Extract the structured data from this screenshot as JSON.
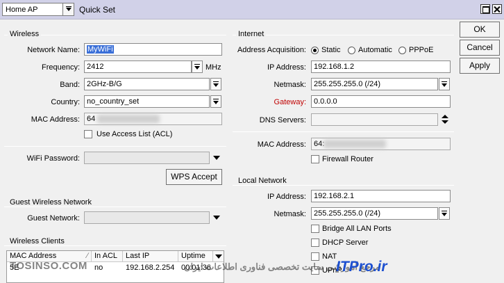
{
  "titlebar": {
    "mode_value": "Home AP",
    "title": "Quick Set"
  },
  "wireless": {
    "group_title": "Wireless",
    "network_name_label": "Network Name:",
    "network_name_value": "MyWiFi",
    "frequency_label": "Frequency:",
    "frequency_value": "2412",
    "frequency_unit": "MHz",
    "band_label": "Band:",
    "band_value": "2GHz-B/G",
    "country_label": "Country:",
    "country_value": "no_country_set",
    "mac_label": "MAC Address:",
    "mac_value_visible": "64",
    "use_acl_label": "Use Access List (ACL)",
    "wifi_password_label": "WiFi Password:",
    "wps_button": "WPS Accept"
  },
  "guest": {
    "group_title": "Guest Wireless Network",
    "network_label": "Guest Network:"
  },
  "clients": {
    "group_title": "Wireless Clients",
    "columns": [
      "MAC Address",
      "In ACL",
      "Last IP",
      "Uptime"
    ],
    "rows": [
      {
        "mac": "5E",
        "in_acl": "no",
        "last_ip": "192.168.2.254",
        "uptime": "00:01:36"
      }
    ]
  },
  "internet": {
    "group_title": "Internet",
    "acq_label": "Address Acquisition:",
    "acq_options": [
      "Static",
      "Automatic",
      "PPPoE"
    ],
    "acq_selected": "Static",
    "ip_label": "IP Address:",
    "ip_value": "192.168.1.2",
    "netmask_label": "Netmask:",
    "netmask_value": "255.255.255.0 (/24)",
    "gateway_label": "Gateway:",
    "gateway_value": "0.0.0.0",
    "dns_label": "DNS Servers:",
    "mac_label": "MAC Address:",
    "mac_value_visible": "64:",
    "firewall_label": "Firewall Router"
  },
  "local": {
    "group_title": "Local Network",
    "ip_label": "IP Address:",
    "ip_value": "192.168.2.1",
    "netmask_label": "Netmask:",
    "netmask_value": "255.255.255.0 (/24)",
    "bridge_label": "Bridge All LAN Ports",
    "dhcp_label": "DHCP Server",
    "nat_label": "NAT",
    "upnp_label": "UPnP"
  },
  "actions": {
    "ok": "OK",
    "cancel": "Cancel",
    "apply": "Apply"
  },
  "watermarks": {
    "left": "TOSINSO.COM",
    "right_persian": "مرجع آموزشی سایت تخصصی فناوری اطلاعات ایران",
    "right_brand": "ITPro.ir"
  },
  "colors": {
    "titlebar_bg": "#d1d1e8",
    "selection": "#3a6fd8",
    "gateway_label": "#c00000",
    "watermark_blue": "#1c4fd0"
  }
}
